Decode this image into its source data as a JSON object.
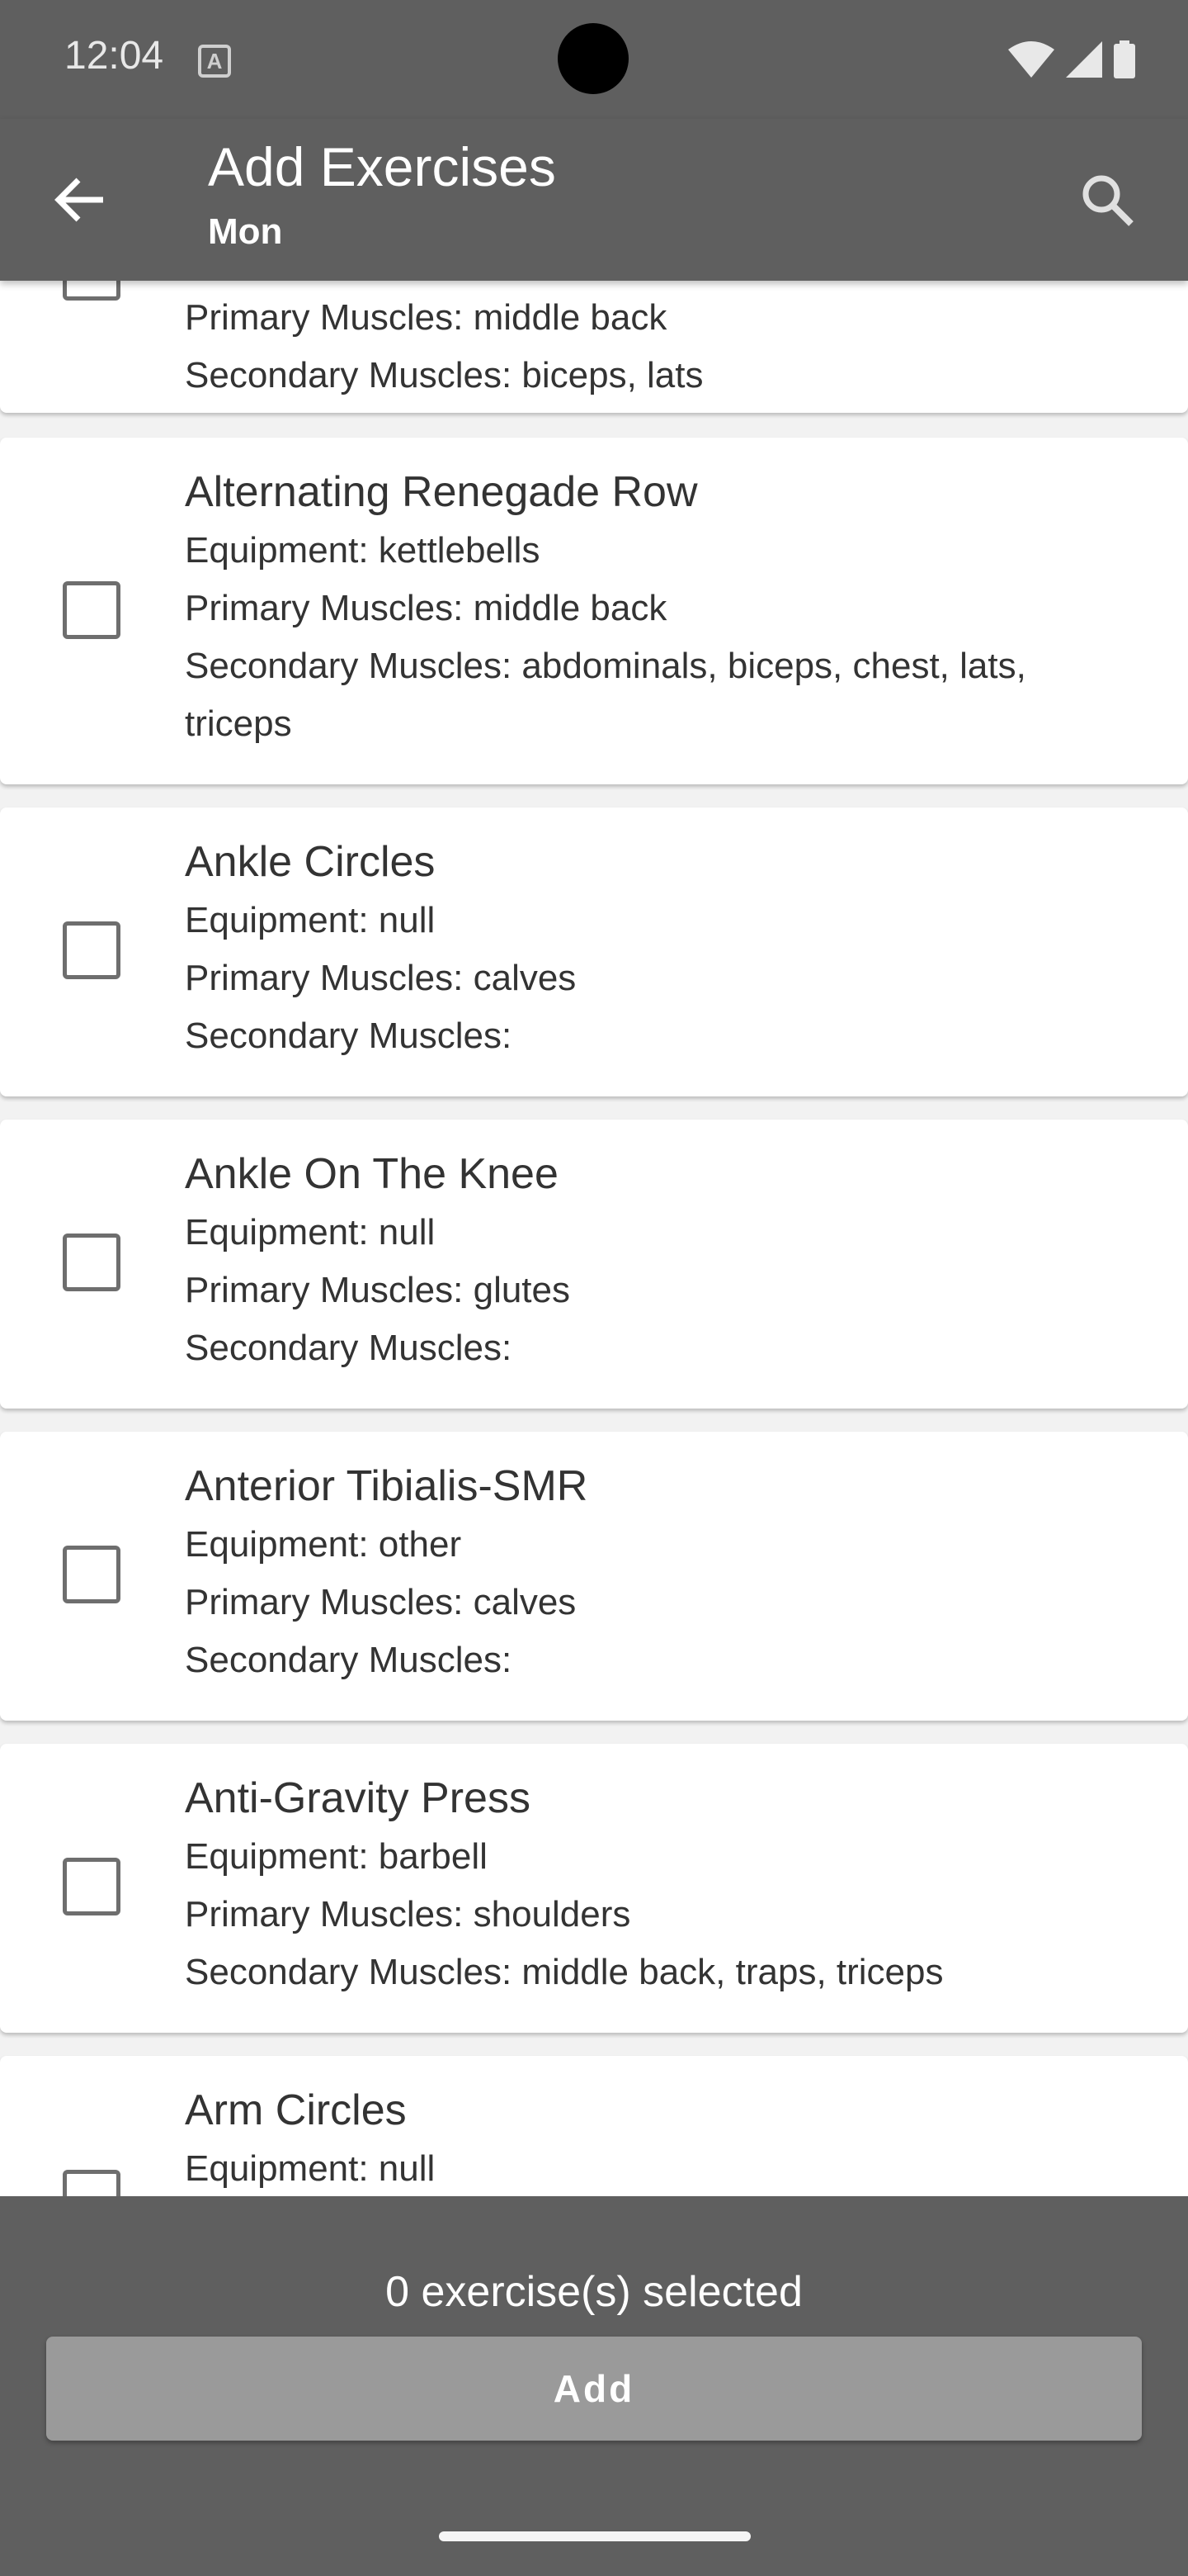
{
  "status_bar": {
    "time": "12:04",
    "a_icon": "A"
  },
  "app_bar": {
    "title": "Add Exercises",
    "subtitle": "Mon"
  },
  "exercises": [
    {
      "name": "",
      "equipment": "",
      "primary": "Primary Muscles: middle back",
      "secondary": "Secondary Muscles: biceps, lats"
    },
    {
      "name": "Alternating Renegade Row",
      "equipment": "Equipment: kettlebells",
      "primary": "Primary Muscles: middle back",
      "secondary": "Secondary Muscles: abdominals, biceps, chest, lats,",
      "secondary_cont": "triceps"
    },
    {
      "name": "Ankle Circles",
      "equipment": "Equipment: null",
      "primary": "Primary Muscles: calves",
      "secondary": "Secondary Muscles:"
    },
    {
      "name": "Ankle On The Knee",
      "equipment": "Equipment: null",
      "primary": "Primary Muscles: glutes",
      "secondary": "Secondary Muscles:"
    },
    {
      "name": "Anterior Tibialis-SMR",
      "equipment": "Equipment: other",
      "primary": "Primary Muscles: calves",
      "secondary": "Secondary Muscles:"
    },
    {
      "name": "Anti-Gravity Press",
      "equipment": "Equipment: barbell",
      "primary": "Primary Muscles: shoulders",
      "secondary": "Secondary Muscles: middle back, traps, triceps"
    },
    {
      "name": "Arm Circles",
      "equipment": "Equipment: null",
      "primary": "",
      "secondary": ""
    }
  ],
  "footer": {
    "selected_text": "0 exercise(s) selected",
    "add_label": "Add"
  },
  "colors": {
    "bar": "#5f5f5f",
    "button_disabled": "#9a9a9a"
  }
}
